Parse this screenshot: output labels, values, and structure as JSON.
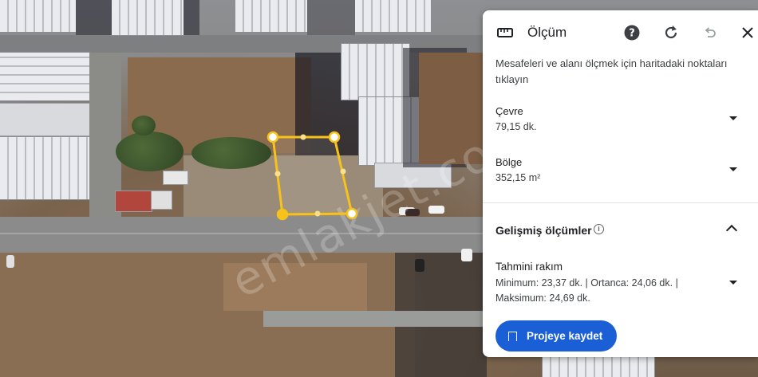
{
  "map": {
    "watermark_text": "emlakjet.com",
    "polygon_color": "#f7c21b"
  },
  "panel": {
    "title": "Ölçüm",
    "icons": [
      "ruler-icon",
      "help-icon",
      "refresh-icon",
      "undo-icon",
      "close-icon"
    ],
    "description": "Mesafeleri ve alanı ölçmek için haritadaki noktaları tıklayın",
    "perimeter": {
      "label": "Çevre",
      "value": "79,15 dk."
    },
    "area": {
      "label": "Bölge",
      "value": "352,15 m²"
    },
    "advanced": {
      "title": "Gelişmiş ölçümler",
      "elevation_title": "Tahmini rakım",
      "elevation_value": "Minimum: 23,37 dk. | Ortanca: 24,06 dk. | Maksimum: 24,69 dk."
    },
    "save_button": "Projeye kaydet",
    "accent_color": "#1a5fd6"
  }
}
